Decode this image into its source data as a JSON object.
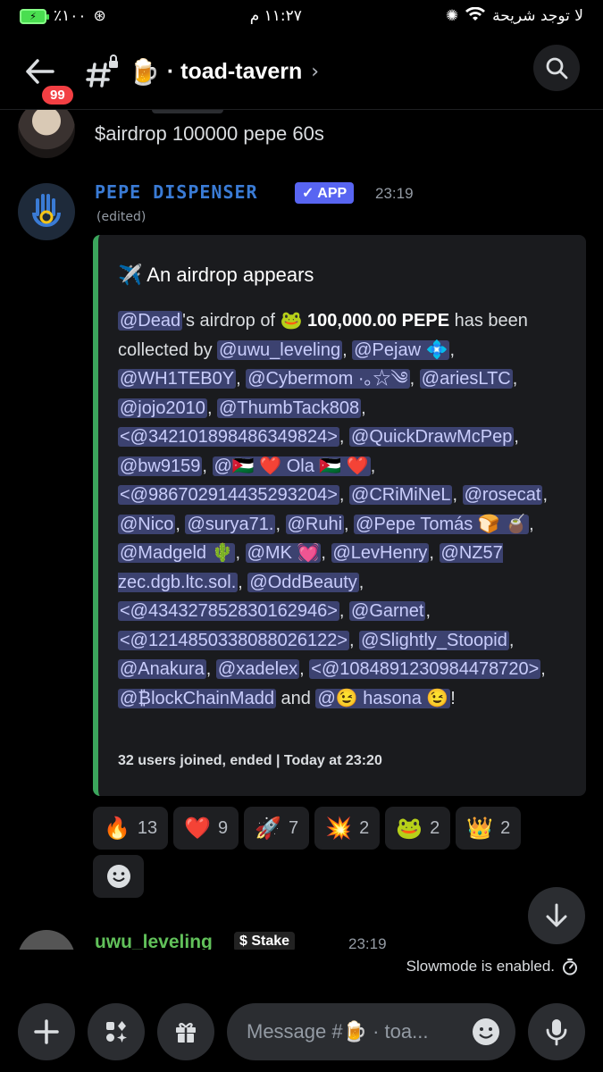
{
  "status_bar": {
    "battery": "٪١٠٠",
    "time": "١١:٢٧ م",
    "carrier": "لا توجد شريحة"
  },
  "header": {
    "badge_count": "99",
    "channel_emoji": "🍺",
    "channel_name": "· toad-tavern",
    "chevron": "›"
  },
  "messages": {
    "previous_text": "$airdrop 100000 pepe 60s",
    "bot": {
      "name": "PEPE DISPENSER",
      "app_tag": "✓ APP",
      "time": "23:19",
      "edited": "(edited)"
    },
    "embed": {
      "title": "✈️ An airdrop appears",
      "footer": "32 users joined, ended | Today at 23:20"
    },
    "reactions": [
      {
        "emoji": "🔥",
        "count": "13"
      },
      {
        "emoji": "❤️",
        "count": "9"
      },
      {
        "emoji": "🚀",
        "count": "7"
      },
      {
        "emoji": "💥",
        "count": "2"
      },
      {
        "emoji": "🐸",
        "count": "2"
      },
      {
        "emoji": "👑",
        "count": "2"
      }
    ],
    "next": {
      "name": "uwu_leveling",
      "tag": "$ Stake",
      "time": "23:19"
    }
  },
  "slowmode": "Slowmode is enabled.",
  "composer": {
    "placeholder": "Message #🍺 · toa..."
  },
  "colors": {
    "accent": "#5865f2",
    "mention_bg": "#3c4270",
    "embed_border": "#3ba55c",
    "badge": "#f23f43"
  }
}
